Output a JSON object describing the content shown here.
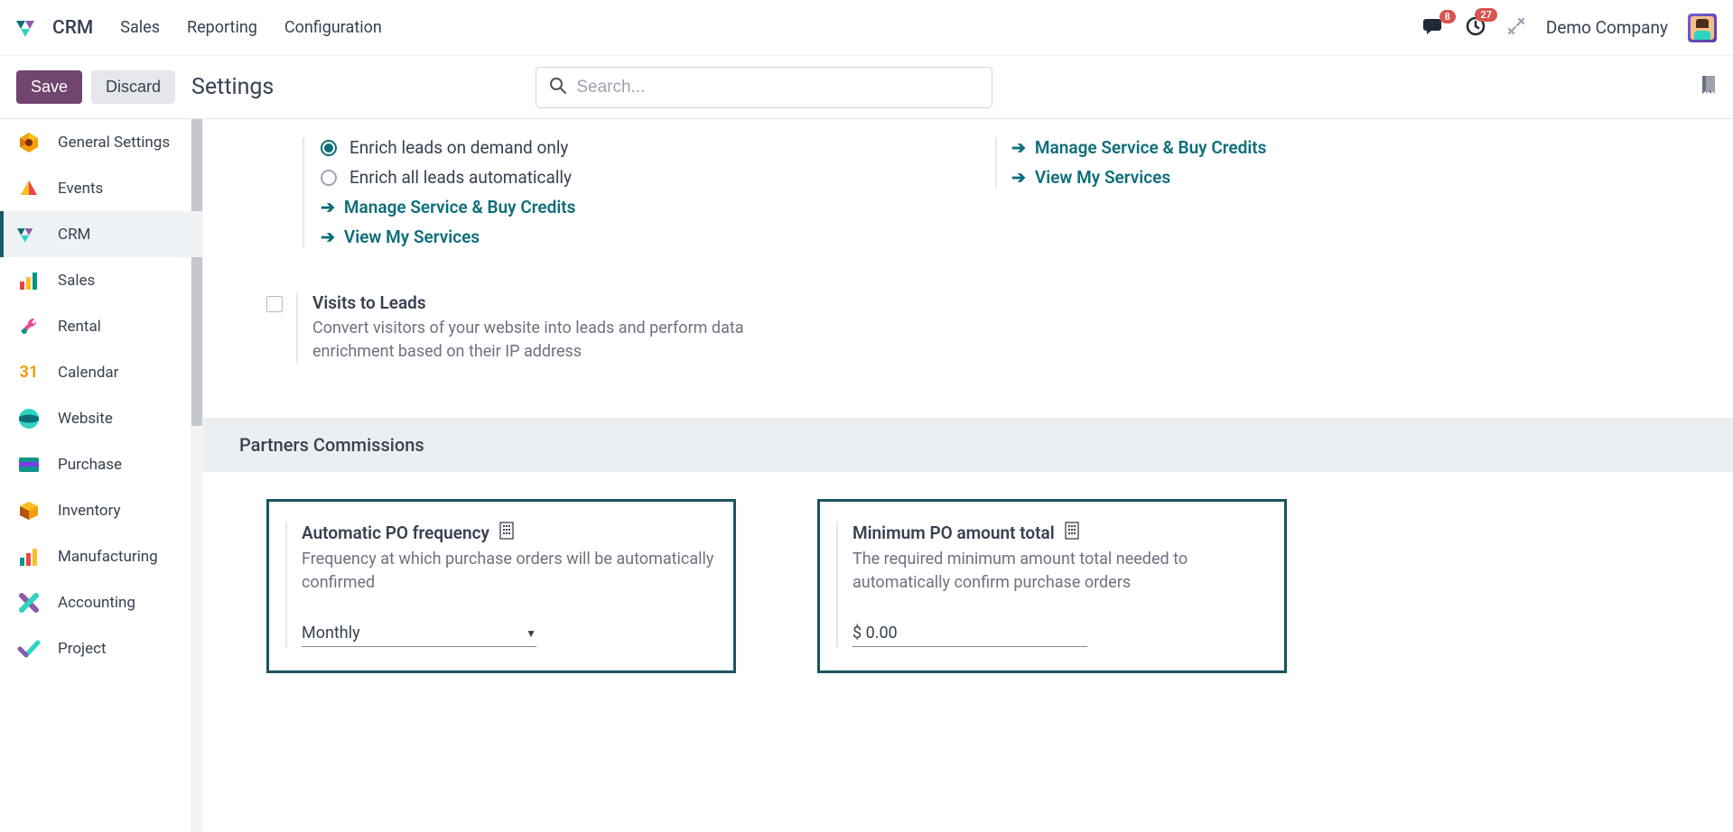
{
  "topnav": {
    "brand": "CRM",
    "links": [
      "Sales",
      "Reporting",
      "Configuration"
    ],
    "msg_badge": "8",
    "activity_badge": "27",
    "company": "Demo Company"
  },
  "controlbar": {
    "save": "Save",
    "discard": "Discard",
    "title": "Settings",
    "search_placeholder": "Search..."
  },
  "sidebar": {
    "items": [
      {
        "label": "General Settings"
      },
      {
        "label": "Events"
      },
      {
        "label": "CRM"
      },
      {
        "label": "Sales"
      },
      {
        "label": "Rental"
      },
      {
        "label": "Calendar"
      },
      {
        "label": "Website"
      },
      {
        "label": "Purchase"
      },
      {
        "label": "Inventory"
      },
      {
        "label": "Manufacturing"
      },
      {
        "label": "Accounting"
      },
      {
        "label": "Project"
      }
    ]
  },
  "enrich": {
    "opt1": "Enrich leads on demand only",
    "opt2": "Enrich all leads automatically",
    "link1": "Manage Service & Buy Credits",
    "link2": "View My Services"
  },
  "right_links": {
    "link1": "Manage Service & Buy Credits",
    "link2": "View My Services"
  },
  "visits": {
    "title": "Visits to Leads",
    "desc": "Convert visitors of your website into leads and perform data enrichment based on their IP address"
  },
  "section": {
    "title": "Partners Commissions"
  },
  "card1": {
    "title": "Automatic PO frequency",
    "desc": "Frequency at which purchase orders will be automatically confirmed",
    "value": "Monthly"
  },
  "card2": {
    "title": "Minimum PO amount total",
    "desc": "The required minimum amount total needed to automatically confirm purchase orders",
    "value": "$ 0.00"
  }
}
